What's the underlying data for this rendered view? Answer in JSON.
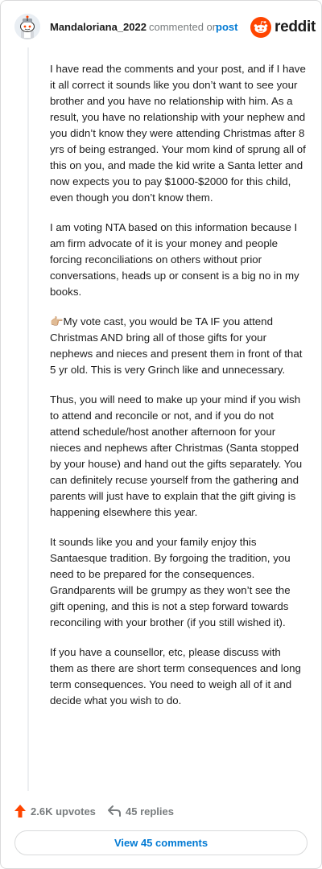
{
  "header": {
    "username": "Mandaloriana_2022",
    "commented_on": "commented on",
    "post_link": "post",
    "brand_name": "reddit",
    "avatar_icon": "snoo-avatar-icon",
    "brand_icon": "reddit-alien-icon"
  },
  "comment": {
    "paragraphs": [
      "I have read the comments and your post, and if I have it all correct it sounds like you don’t want to see your brother and you have no relationship with him. As a result, you have no relationship with your nephew and you didn’t know they were attending Christmas after 8 yrs of being estranged. Your mom kind of sprung all of this on you, and made the kid write a Santa letter and now expects you to pay $1000-$2000 for this child, even though you don’t know them.",
      "I am voting NTA based on this information because I am firm advocate of it is your money and people forcing reconciliations on others without prior conversations, heads up or consent is a big no in my books.",
      "👉🏼My vote cast, you would be TA IF you attend Christmas AND bring all of those gifts for your nephews and nieces and present them in front of that 5 yr old. This is very Grinch like and unnecessary.",
      "Thus, you will need to make up your mind if you wish to attend and reconcile or not, and if you do not attend schedule/host another afternoon for your nieces and nephews after Christmas (Santa stopped by your house) and hand out the gifts separately. You can definitely recuse yourself from the gathering and parents will just have to explain that the gift giving is happening elsewhere this year.",
      "It sounds like you and your family enjoy this Santaesque tradition. By forgoing the tradition, you need to be prepared for the consequences. Grandparents will be grumpy as they won’t see the gift opening, and this is not a step forward towards reconciling with your brother (if you still wished it).",
      "If you have a counsellor, etc, please discuss with them as there are short term consequences and long term consequences. You need to weigh all of it and decide what you wish to do."
    ]
  },
  "footer": {
    "upvotes_label": "2.6K upvotes",
    "replies_label": "45 replies",
    "view_comments_label": "View 45 comments",
    "upvote_icon": "upvote-arrow-icon",
    "reply_icon": "reply-arrow-icon"
  },
  "colors": {
    "upvote_orange": "#ff4500",
    "link_blue": "#0079d3",
    "meta_gray": "#787c7e",
    "border": "#d9dadb",
    "text": "#1c1c1c"
  }
}
